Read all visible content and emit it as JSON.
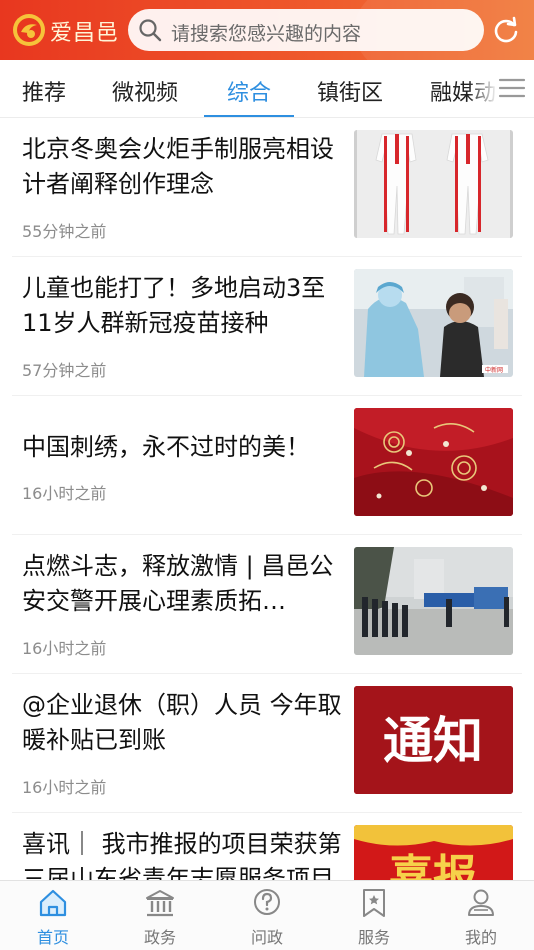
{
  "header": {
    "app_name": "爱昌邑",
    "search_placeholder": "请搜索您感兴趣的内容",
    "logo_icon": "app-logo-icon",
    "refresh_icon": "refresh-icon",
    "brand_color": "#e8371f"
  },
  "tabs": [
    {
      "label": "推荐",
      "active": false
    },
    {
      "label": "微视频",
      "active": false
    },
    {
      "label": "综合",
      "active": true
    },
    {
      "label": "镇街区",
      "active": false
    },
    {
      "label": "融媒动",
      "active": false
    }
  ],
  "tab_menu_icon": "menu-icon",
  "accent_color": "#2e8fe0",
  "news": [
    {
      "title": "北京冬奥会火炬手制服亮相设计者阐释创作理念",
      "time": "55分钟之前",
      "image": "torchbearer-uniform-photo"
    },
    {
      "title": "儿童也能打了！多地启动3至11岁人群新冠疫苗接种",
      "time": "57分钟之前",
      "image": "child-vaccination-photo"
    },
    {
      "title": "中国刺绣，永不过时的美！",
      "time": "16小时之前",
      "image": "red-embroidery-photo"
    },
    {
      "title": "点燃斗志，释放激情 | 昌邑公安交警开展心理素质拓…",
      "time": "16小时之前",
      "image": "traffic-police-training-photo"
    },
    {
      "title": "@企业退休（职）人员 今年取暖补贴已到账",
      "time": "16小时之前",
      "image": "notice-banner",
      "image_text": "通知"
    },
    {
      "title": "喜讯｜ 我市推报的项目荣获第三届山东省青年志愿服务项目大赛…",
      "time": "",
      "image": "good-news-banner",
      "image_text": "喜报"
    }
  ],
  "bottom_nav": [
    {
      "label": "首页",
      "icon": "home-icon",
      "active": true
    },
    {
      "label": "政务",
      "icon": "government-icon",
      "active": false
    },
    {
      "label": "问政",
      "icon": "question-icon",
      "active": false
    },
    {
      "label": "服务",
      "icon": "service-bookmark-icon",
      "active": false
    },
    {
      "label": "我的",
      "icon": "profile-icon",
      "active": false
    }
  ]
}
